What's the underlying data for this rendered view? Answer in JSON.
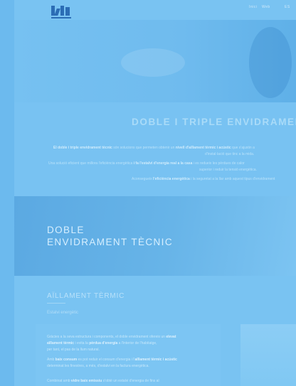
{
  "header": {
    "nav_items": [
      "Inici",
      "Web",
      "ES"
    ]
  },
  "intro": {
    "title": "DOBLE I TRIPLE ENVIDRAMENT",
    "p1a_bold": "El doble i triple envidrament tècnic",
    "p1a": " són solucions que permeten obtenir un ",
    "p1a_bold2": "nivell d'aïllament tèrmic i acústic",
    "p1a_tail": " que s'ajustin a",
    "p1b": "d'instal·lació que tinc a la mida.",
    "p2a": "Una solució eficient que millora l'eficiència energètica ",
    "p2a_bold": "i fa l'estalvi d'energia real a la casa",
    "p2a_tail": " i es redueix les pèrdues de calor",
    "p2b": "superior i reduir la tensió energètica.",
    "p3a": "Aconsegueix ",
    "p3a_bold": "l'eficiència energètica",
    "p3a_tail": " i la seguretat a la llar amb aquest tipus d'envidrament"
  },
  "banner": {
    "line1": "DOBLE",
    "line2": "ENVIDRAMENT TÈCNIC"
  },
  "thermal": {
    "title": "AÏLLAMENT TÈRMIC",
    "subtitle": "Estalvi energètic",
    "p1a": "Gràcies a la seva estructura i components, el doble envidrament ofereix un ",
    "p1a_bold": "elevat",
    "p1b_bold": "aïllament tèrmic",
    "p1b": " i evita la ",
    "p1b_bold2": "pèrdua d'energia",
    "p1b_tail": " a l'interior de l'habitatge,",
    "p1c": "per tant, el pas de la llum natural.",
    "p2a": "Amb ",
    "p2a_bold": "baix consum",
    "p2a_tail": " es pot reduir el consum d'energia i l'",
    "p2a_bold2": "aïllament tèrmic i acústic",
    "p2b": "determinat les finestres, a més, d'estalvi en la factura energètica.",
    "p3a": "Combinat amb ",
    "p3a_bold": "vidre baix emissiu",
    "p3a_tail": " s'obté un estalvi d'energia de fins al "
  },
  "colors": {
    "overlay": "#74c0f1",
    "logo": "#2b6db5"
  }
}
